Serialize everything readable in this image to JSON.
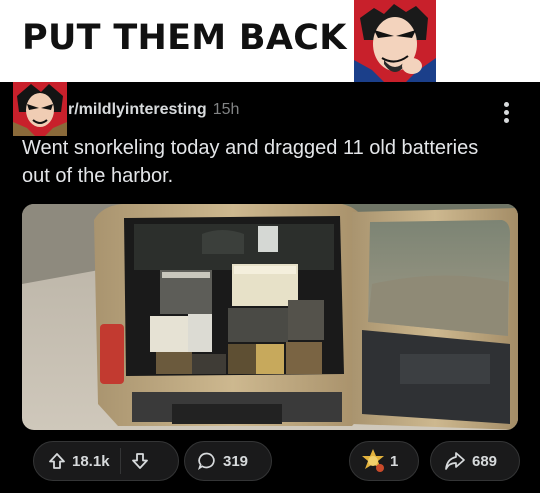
{
  "meme": {
    "caption": "PUT THEM BACK",
    "reaction_icon": "villain-face-icon"
  },
  "post": {
    "subreddit": "r/mildlyinteresting",
    "age": "15h",
    "title": "Went snorkeling today and dragged 11 old batteries out of the harbor.",
    "image_icon": "car-trunk-batteries-photo",
    "upvotes": "18.1k",
    "comments": "319",
    "awards": "1",
    "shares": "689"
  },
  "colors": {
    "background": "#000000",
    "pill_bg": "#1a1a1b",
    "text": "#d7dadc",
    "muted": "#818384"
  }
}
